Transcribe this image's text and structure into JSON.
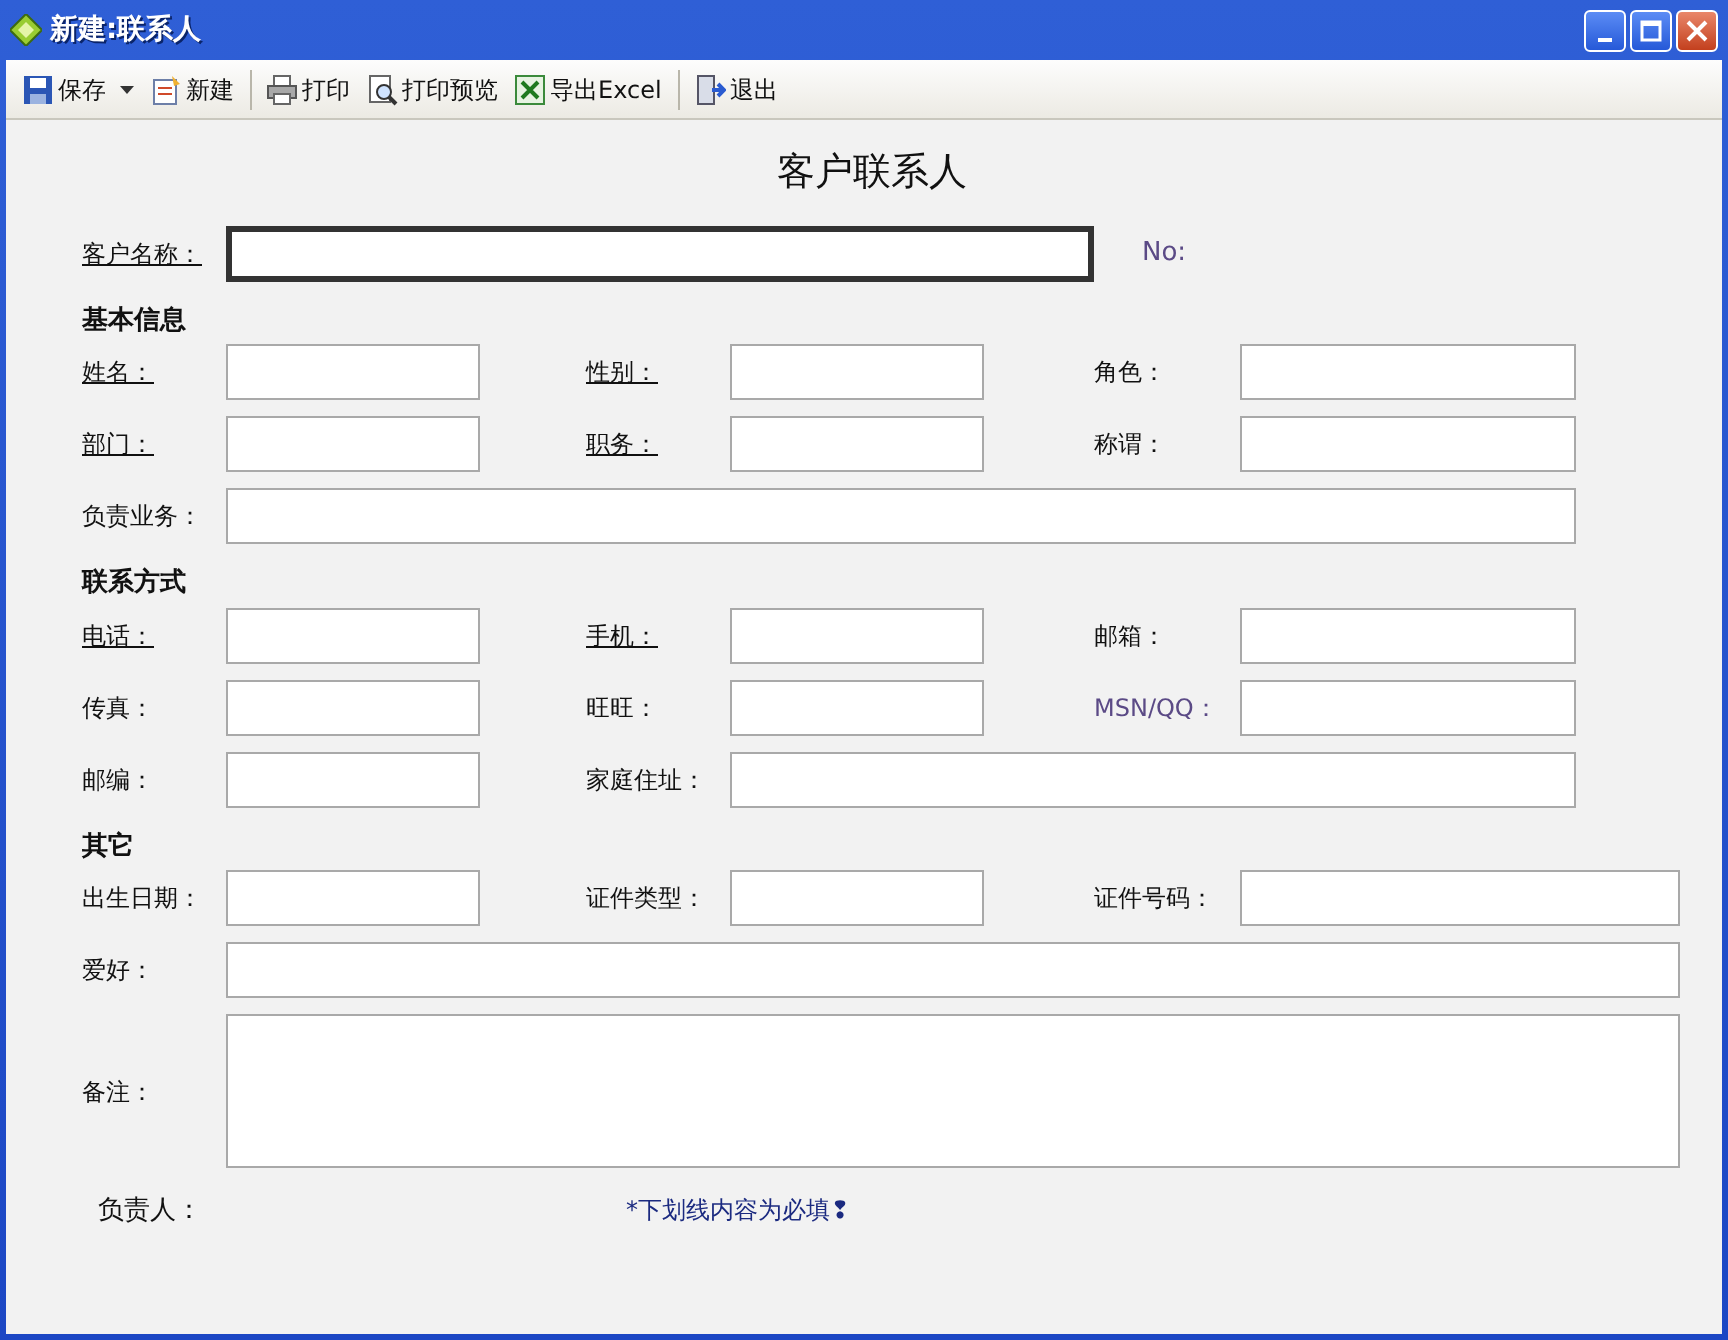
{
  "window": {
    "title": "新建:联系人"
  },
  "toolbar": [
    {
      "label": "保存",
      "has_menu": true,
      "separator_before": false
    },
    {
      "label": "新建",
      "has_menu": false,
      "separator_before": false
    },
    {
      "label": "打印",
      "has_menu": false,
      "separator_before": true
    },
    {
      "label": "打印预览",
      "has_menu": false,
      "separator_before": false
    },
    {
      "label": "导出Excel",
      "has_menu": false,
      "separator_before": false
    },
    {
      "label": "退出",
      "has_menu": false,
      "separator_before": true
    }
  ],
  "form_title": "客户联系人",
  "customer": {
    "label": "客户名称：",
    "required": true,
    "focused": true,
    "number_label": "No:"
  },
  "sections": [
    {
      "heading": "基本信息",
      "rows": [
        [
          {
            "label": "姓名：",
            "required": true,
            "kind": "short"
          },
          {
            "label": "性别：",
            "required": true,
            "kind": "short"
          },
          {
            "label": "角色：",
            "required": false,
            "kind": "short"
          }
        ],
        [
          {
            "label": "部门：",
            "required": true,
            "kind": "short"
          },
          {
            "label": "职务：",
            "required": true,
            "kind": "short"
          },
          {
            "label": "称谓：",
            "required": false,
            "kind": "short"
          }
        ],
        [
          {
            "label": "负责业务：",
            "required": false,
            "kind": "wide"
          }
        ]
      ]
    },
    {
      "heading": "联系方式",
      "rows": [
        [
          {
            "label": "电话：",
            "required": true,
            "kind": "short"
          },
          {
            "label": "手机：",
            "required": true,
            "kind": "short"
          },
          {
            "label": "邮箱：",
            "required": false,
            "kind": "short"
          }
        ],
        [
          {
            "label": "传真：",
            "required": false,
            "kind": "short"
          },
          {
            "label": "旺旺：",
            "required": false,
            "kind": "short"
          },
          {
            "label": "MSN/QQ：",
            "required": false,
            "kind": "short",
            "color": "#5b4a86"
          }
        ],
        [
          {
            "label": "邮编：",
            "required": false,
            "kind": "short"
          },
          {
            "label": "家庭住址：",
            "required": false,
            "kind": "wide"
          }
        ]
      ]
    },
    {
      "heading": "其它",
      "rows": [
        [
          {
            "label": "出生日期：",
            "required": false,
            "kind": "short"
          },
          {
            "label": "证件类型：",
            "required": false,
            "kind": "short"
          },
          {
            "label": "证件号码：",
            "required": false,
            "kind": "full"
          }
        ],
        [
          {
            "label": "爱好：",
            "required": false,
            "kind": "full"
          }
        ],
        [
          {
            "label": "备注：",
            "required": false,
            "kind": "notes"
          }
        ]
      ]
    }
  ],
  "footer": {
    "owner_label": "负责人：",
    "note": "*下划线内容为必填❢"
  }
}
